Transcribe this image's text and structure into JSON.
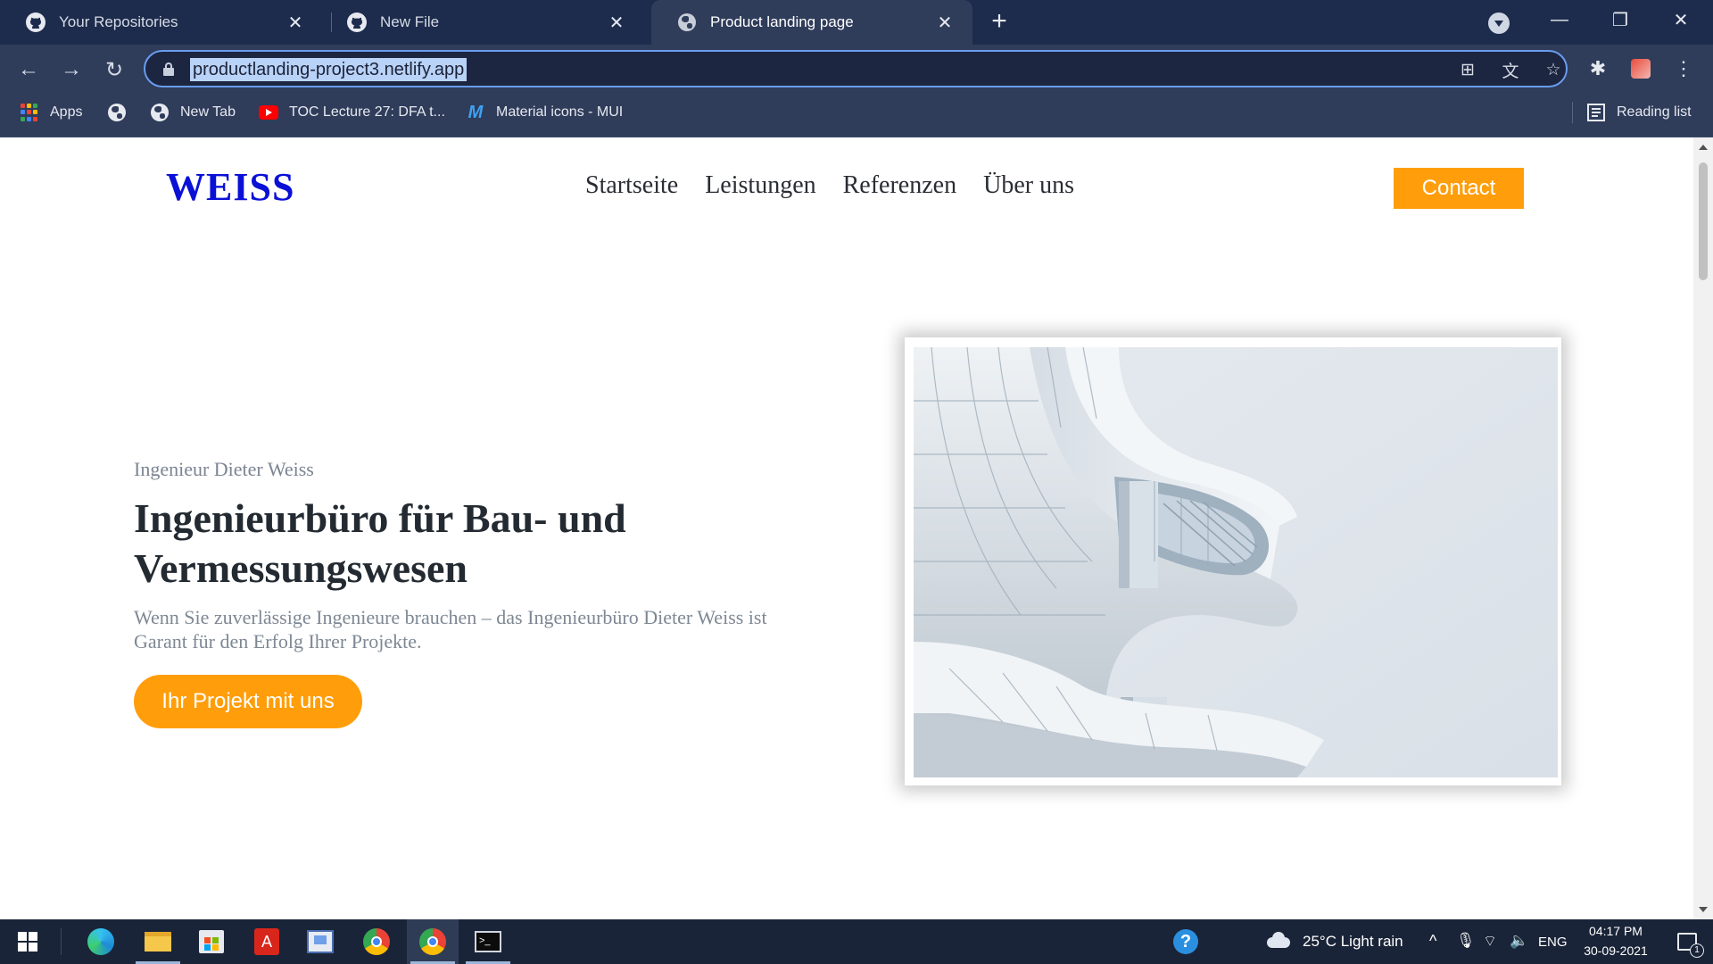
{
  "browser": {
    "tabs": [
      {
        "title": "Your Repositories",
        "icon": "github-icon"
      },
      {
        "title": "New File",
        "icon": "github-icon"
      },
      {
        "title": "Product landing page",
        "icon": "globe-icon",
        "active": true
      }
    ],
    "url": "productlanding-project3.netlify.app",
    "bookmarks": {
      "apps": "Apps",
      "new_tab": "New Tab",
      "toc": "TOC Lecture 27: DFA t...",
      "mui": "Material icons - MUI",
      "reading_list": "Reading list"
    }
  },
  "page": {
    "logo": "WEISS",
    "nav": [
      "Startseite",
      "Leistungen",
      "Referenzen",
      "Über uns"
    ],
    "contact": "Contact",
    "hero": {
      "eyebrow": "Ingenieur Dieter Weiss",
      "headline": "Ingenieurbüro für Bau- und Vermessungswesen",
      "lead": "Wenn Sie zuverlässige Ingenieure brauchen – das Ingenieurbüro Dieter Weiss ist Garant für den Erfolg Ihrer Projekte.",
      "cta": "Ihr Projekt mit uns"
    }
  },
  "taskbar": {
    "weather": "25°C  Light rain",
    "lang": "ENG",
    "time": "04:17 PM",
    "date": "30-09-2021",
    "notifications": "1"
  },
  "colors": {
    "accent": "#ff9e0a",
    "logo": "#0a10d6",
    "chrome": "#2f3c5a"
  }
}
